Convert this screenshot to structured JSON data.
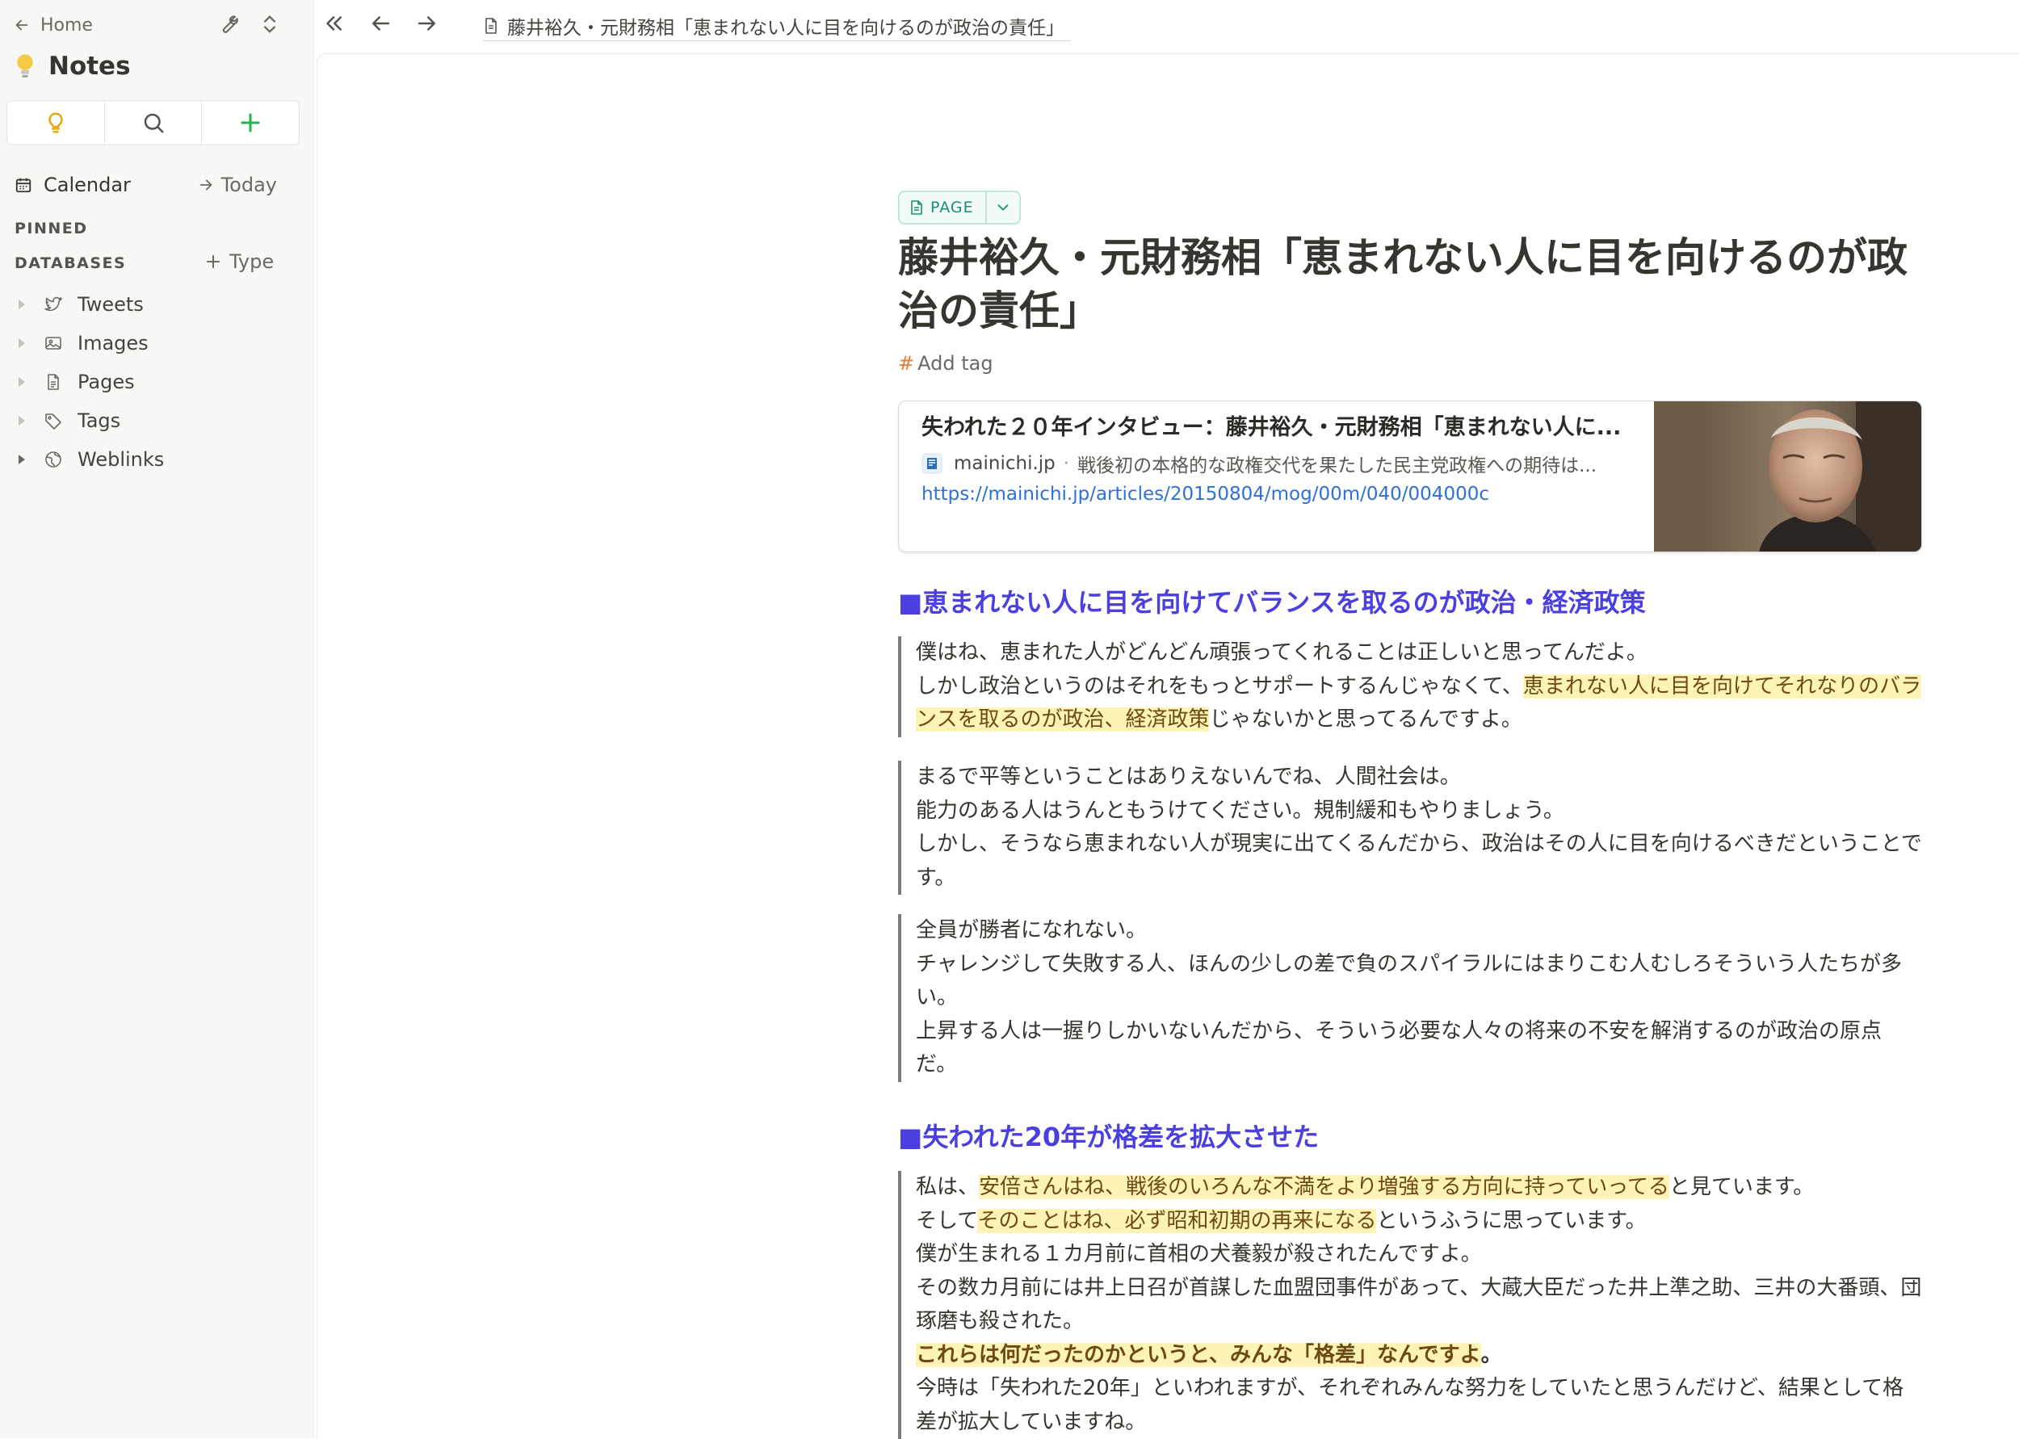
{
  "sidebar": {
    "home_label": "Home",
    "notes_title": "Notes",
    "calendar_label": "Calendar",
    "today_label": "Today",
    "pinned_label": "PINNED",
    "databases_label": "DATABASES",
    "add_type_label": "Type",
    "items": [
      {
        "label": "Tweets",
        "icon": "twitter-bird-icon"
      },
      {
        "label": "Images",
        "icon": "image-icon"
      },
      {
        "label": "Pages",
        "icon": "page-icon"
      },
      {
        "label": "Tags",
        "icon": "tag-icon"
      },
      {
        "label": "Weblinks",
        "icon": "globe-icon"
      }
    ]
  },
  "topbar": {
    "tab_title": "藤井裕久・元財務相「恵まれない人に目を向けるのが政治の責任」"
  },
  "doc": {
    "badge_label": "PAGE",
    "title": "藤井裕久・元財務相「恵まれない人に目を向けるのが政治の責任」",
    "add_tag_hash": "#",
    "add_tag_label": "Add tag",
    "link_card": {
      "title": "失われた２０年インタビュー：藤井裕久・元財務相「恵まれない人に...",
      "site": "mainichi.jp",
      "separator": "·",
      "description": "戦後初の本格的な政権交代を果たした民主党政権への期待は...",
      "url": "https://mainichi.jp/articles/20150804/mog/00m/040/004000c"
    },
    "section1_heading": "■恵まれない人に目を向けてバランスを取るのが政治・経済政策",
    "q1": {
      "l1": "僕はね、恵まれた人がどんどん頑張ってくれることは正しいと思ってんだよ。",
      "l2a": "しかし政治というのはそれをもっとサポートするんじゃなくて、",
      "l2hl": "恵まれない人に目を向けてそれなりのバランスを取るのが政治、経済政策",
      "l2b": "じゃないかと思ってるんですよ。"
    },
    "q2": {
      "l1": "まるで平等ということはありえないんでね、人間社会は。",
      "l2": "能力のある人はうんともうけてください。規制緩和もやりましょう。",
      "l3": "しかし、そうなら恵まれない人が現実に出てくるんだから、政治はその人に目を向けるべきだということです。"
    },
    "q3": {
      "l1": "全員が勝者になれない。",
      "l2": "チャレンジして失敗する人、ほんの少しの差で負のスパイラルにはまりこむ人むしろそういう人たちが多い。",
      "l3": "上昇する人は一握りしかいないんだから、そういう必要な人々の将来の不安を解消するのが政治の原点だ。"
    },
    "section2_heading": "■失われた20年が格差を拡大させた",
    "q4": {
      "l1a": "私は、",
      "l1hl": "安倍さんはね、戦後のいろんな不満をより増強する方向に持っていってる",
      "l1b": "と見ています。",
      "l2a": "そして",
      "l2hl": "そのことはね、必ず昭和初期の再来になる",
      "l2b": "というふうに思っています。",
      "l3": "僕が生まれる１カ月前に首相の犬養毅が殺されたんですよ。",
      "l4": "その数カ月前には井上日召が首謀した血盟団事件があって、大蔵大臣だった井上準之助、三井の大番頭、団琢磨も殺された。",
      "l5hl": "これらは何だったのかというと、みんな「格差」なんですよ",
      "l5b": "。",
      "l6": "今時は「失われた20年」といわれますが、それぞれみんな努力をしていたと思うんだけど、結果として格差が拡大していますね。"
    }
  },
  "colors": {
    "accent_heading": "#4b3fe0",
    "highlight_bg": "#fdf3b7",
    "badge_green": "#1c8e72",
    "link_blue": "#2f6fd8",
    "tag_hash": "#e8792d"
  }
}
